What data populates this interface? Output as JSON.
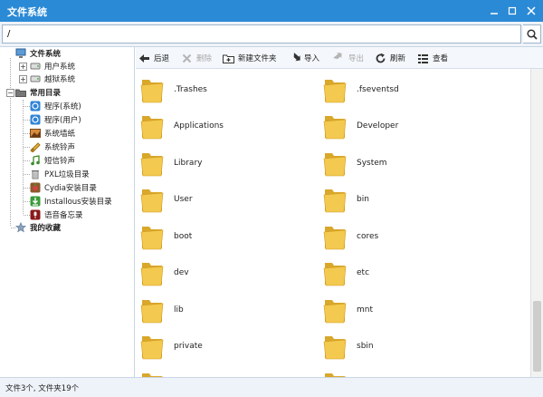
{
  "window": {
    "title": "文件系统"
  },
  "address": {
    "path": "/"
  },
  "sidebar": {
    "file_system": "文件系统",
    "user_system": "用户系统",
    "jailbreak_system": "越狱系统",
    "common_dirs": "常用目录",
    "programs_system": "程序(系统)",
    "programs_user": "程序(用户)",
    "system_wallpaper": "系统墙纸",
    "system_ringtone": "系统铃声",
    "sms_ringtone": "短信铃声",
    "pxl_trash": "PXL垃圾目录",
    "cydia_install": "Cydia安装目录",
    "installous_install": "Installous安装目录",
    "voice_memos": "语音备忘录",
    "favorites": "我的收藏"
  },
  "toolbar": {
    "back": "后退",
    "delete": "删除",
    "new_folder": "新建文件夹",
    "import": "导入",
    "export": "导出",
    "refresh": "刷新",
    "view": "查看"
  },
  "files": [
    ".Trashes",
    ".fseventsd",
    "Applications",
    "Developer",
    "Library",
    "System",
    "User",
    "bin",
    "boot",
    "cores",
    "dev",
    "etc",
    "lib",
    "mnt",
    "private",
    "sbin"
  ],
  "status": {
    "text": "文件3个, 文件夹19个"
  },
  "colors": {
    "titlebar": "#2b8ad6",
    "folder": "#f3c94f",
    "folder_dark": "#d9a72a"
  }
}
